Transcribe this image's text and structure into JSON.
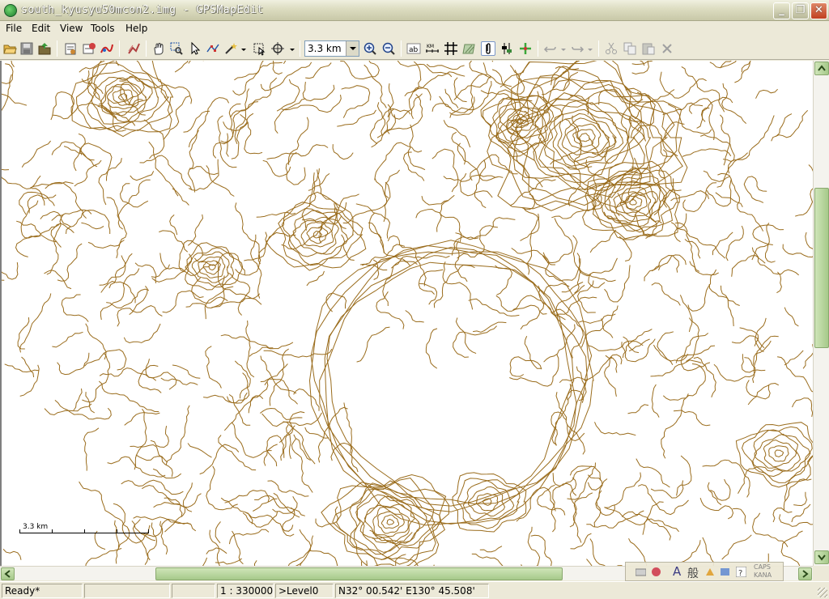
{
  "window": {
    "title": "south_kyusyu50mcon2.img - GPSMapEdit"
  },
  "menu": {
    "file": "File",
    "edit": "Edit",
    "view": "View",
    "tools": "Tools",
    "help": "Help"
  },
  "toolbar": {
    "scale_value": "3.3 km"
  },
  "map": {
    "contour_color": "#9a6c1c",
    "scale_bar_label": "3.3 km"
  },
  "status": {
    "state": "Ready*",
    "scale": "1 : 330000",
    "level": ">Level0",
    "coords": "N32°  00.542' E130°  45.508'"
  },
  "ime": {
    "caps": "CAPS",
    "kana": "KANA"
  }
}
